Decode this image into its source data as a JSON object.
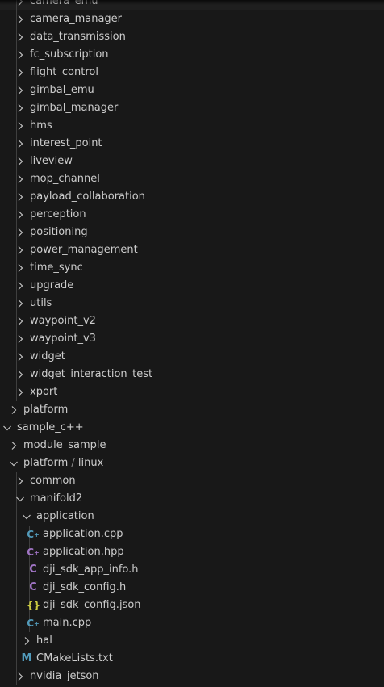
{
  "explorer": {
    "items": [
      {
        "label": "camera_emu",
        "depth": 1,
        "type": "folder",
        "expanded": false
      },
      {
        "label": "camera_manager",
        "depth": 1,
        "type": "folder",
        "expanded": false
      },
      {
        "label": "data_transmission",
        "depth": 1,
        "type": "folder",
        "expanded": false
      },
      {
        "label": "fc_subscription",
        "depth": 1,
        "type": "folder",
        "expanded": false
      },
      {
        "label": "flight_control",
        "depth": 1,
        "type": "folder",
        "expanded": false
      },
      {
        "label": "gimbal_emu",
        "depth": 1,
        "type": "folder",
        "expanded": false
      },
      {
        "label": "gimbal_manager",
        "depth": 1,
        "type": "folder",
        "expanded": false
      },
      {
        "label": "hms",
        "depth": 1,
        "type": "folder",
        "expanded": false
      },
      {
        "label": "interest_point",
        "depth": 1,
        "type": "folder",
        "expanded": false
      },
      {
        "label": "liveview",
        "depth": 1,
        "type": "folder",
        "expanded": false
      },
      {
        "label": "mop_channel",
        "depth": 1,
        "type": "folder",
        "expanded": false
      },
      {
        "label": "payload_collaboration",
        "depth": 1,
        "type": "folder",
        "expanded": false
      },
      {
        "label": "perception",
        "depth": 1,
        "type": "folder",
        "expanded": false
      },
      {
        "label": "positioning",
        "depth": 1,
        "type": "folder",
        "expanded": false
      },
      {
        "label": "power_management",
        "depth": 1,
        "type": "folder",
        "expanded": false
      },
      {
        "label": "time_sync",
        "depth": 1,
        "type": "folder",
        "expanded": false
      },
      {
        "label": "upgrade",
        "depth": 1,
        "type": "folder",
        "expanded": false
      },
      {
        "label": "utils",
        "depth": 1,
        "type": "folder",
        "expanded": false
      },
      {
        "label": "waypoint_v2",
        "depth": 1,
        "type": "folder",
        "expanded": false
      },
      {
        "label": "waypoint_v3",
        "depth": 1,
        "type": "folder",
        "expanded": false
      },
      {
        "label": "widget",
        "depth": 1,
        "type": "folder",
        "expanded": false
      },
      {
        "label": "widget_interaction_test",
        "depth": 1,
        "type": "folder",
        "expanded": false
      },
      {
        "label": "xport",
        "depth": 1,
        "type": "folder",
        "expanded": false
      },
      {
        "label": "platform",
        "depth": 0,
        "type": "folder",
        "expanded": false
      },
      {
        "label": "sample_c++",
        "depth": -1,
        "type": "folder",
        "expanded": true
      },
      {
        "label": "module_sample",
        "depth": 0,
        "type": "folder",
        "expanded": false
      },
      {
        "label": "platform",
        "label2": "linux",
        "depth": 0,
        "type": "folder",
        "expanded": true
      },
      {
        "label": "common",
        "depth": 1,
        "type": "folder",
        "expanded": false
      },
      {
        "label": "manifold2",
        "depth": 1,
        "type": "folder",
        "expanded": true
      },
      {
        "label": "application",
        "depth": 2,
        "type": "folder",
        "expanded": true
      },
      {
        "label": "application.cpp",
        "depth": 3,
        "type": "file",
        "icon": "cpp-file-icon",
        "glyph": "C",
        "suffix": "+",
        "color": "#519aba"
      },
      {
        "label": "application.hpp",
        "depth": 3,
        "type": "file",
        "icon": "hpp-file-icon",
        "glyph": "C",
        "suffix": "+",
        "color": "#a074c4"
      },
      {
        "label": "dji_sdk_app_info.h",
        "depth": 3,
        "type": "file",
        "icon": "c-header-file-icon",
        "glyph": "C",
        "color": "#a074c4"
      },
      {
        "label": "dji_sdk_config.h",
        "depth": 3,
        "type": "file",
        "icon": "c-header-file-icon",
        "glyph": "C",
        "color": "#a074c4"
      },
      {
        "label": "dji_sdk_config.json",
        "depth": 3,
        "type": "file",
        "icon": "json-file-icon",
        "glyph": "{}",
        "color": "#cbcb41"
      },
      {
        "label": "main.cpp",
        "depth": 3,
        "type": "file",
        "icon": "cpp-file-icon",
        "glyph": "C",
        "suffix": "+",
        "color": "#519aba"
      },
      {
        "label": "hal",
        "depth": 2,
        "type": "folder",
        "expanded": false
      },
      {
        "label": "CMakeLists.txt",
        "depth": 2,
        "type": "file",
        "icon": "cmake-file-icon",
        "glyph": "M",
        "color": "#519aba"
      },
      {
        "label": "nvidia_jetson",
        "depth": 1,
        "type": "folder",
        "expanded": false
      }
    ]
  },
  "colors": {
    "background": "#181818",
    "text": "#cccccc",
    "indent_guide": "#3f3f3f",
    "chevron": "#c5c5c5"
  }
}
